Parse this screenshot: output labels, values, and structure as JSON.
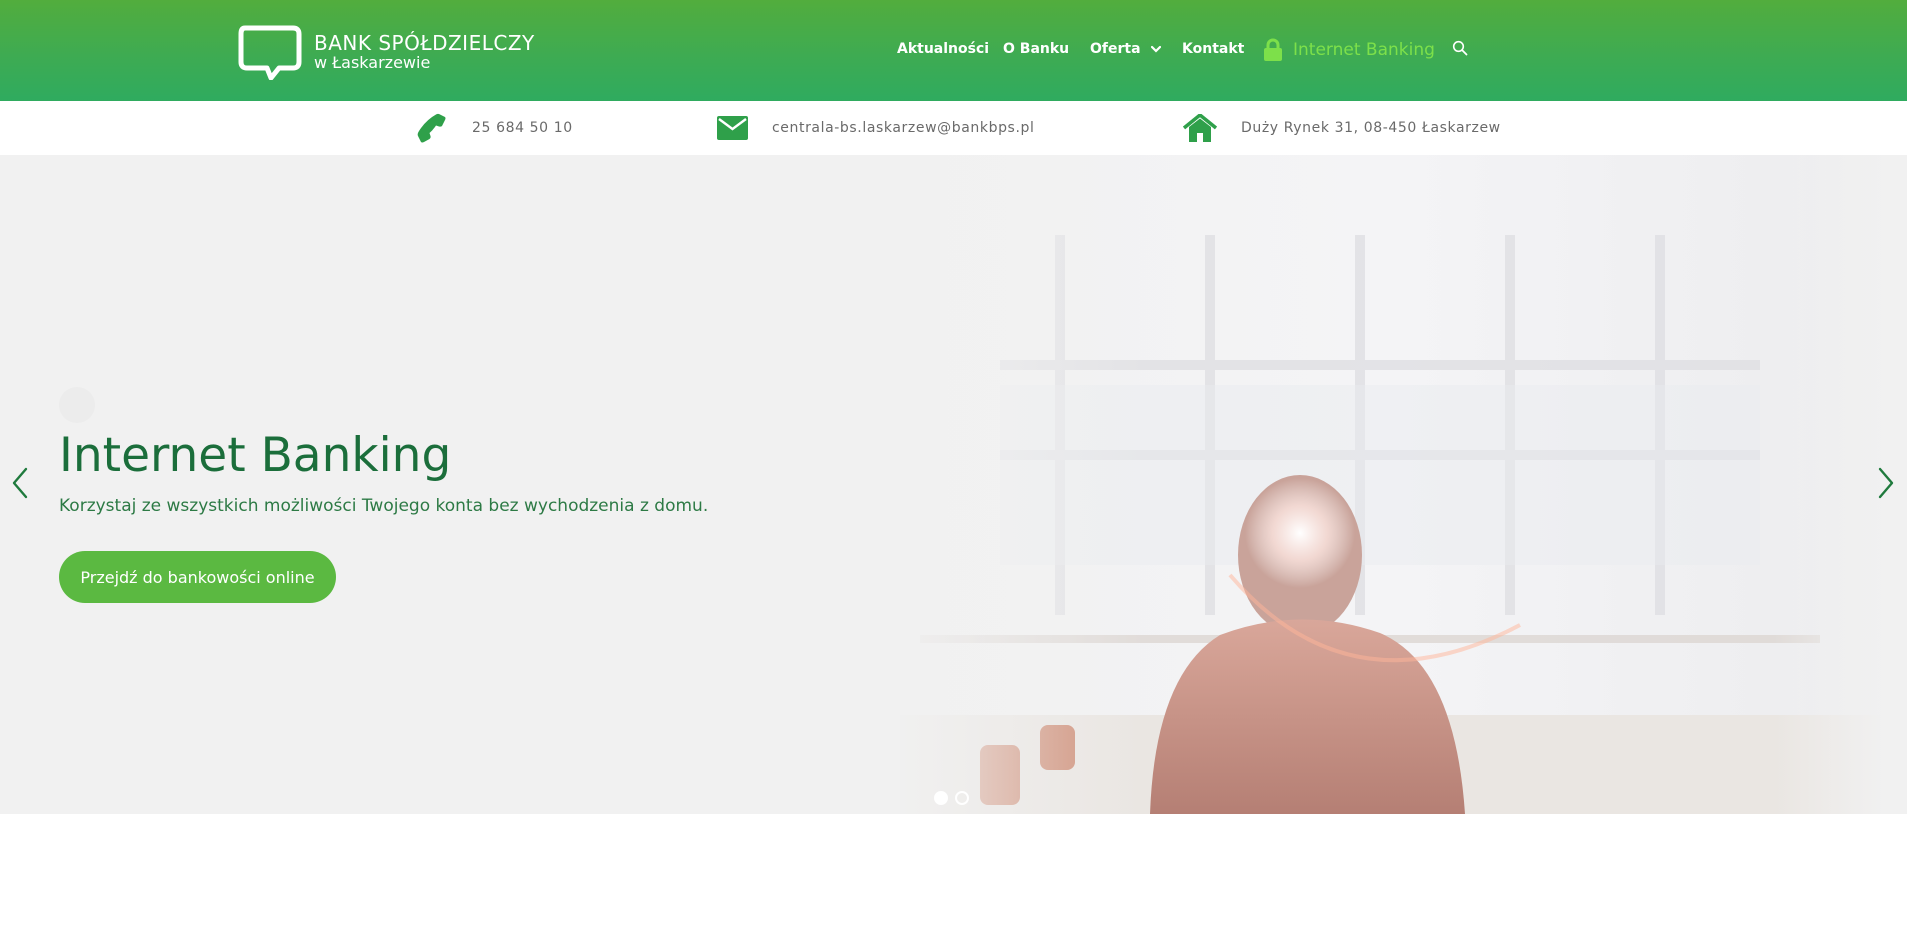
{
  "brand": {
    "name_line1": "BANK SPÓŁDZIELCZY",
    "name_line2": "w Łaskarzewie"
  },
  "nav": {
    "items": [
      {
        "label": "Aktualności"
      },
      {
        "label": "O Banku"
      },
      {
        "label": "Oferta",
        "has_dropdown": true
      },
      {
        "label": "Kontakt"
      }
    ],
    "internet_banking_label": "Internet Banking"
  },
  "contacts": {
    "phone": "25 684 50 10",
    "email": "centrala-bs.laskarzew@bankbps.pl",
    "address": "Duży Rynek 31, 08-450 Łaskarzew"
  },
  "hero": {
    "title": "Internet Banking",
    "subtitle": "Korzystaj ze wszystkich możliwości Twojego konta bez wychodzenia z domu.",
    "cta_label": "Przejdź do bankowości online",
    "slide_count": 2,
    "active_slide": 1
  },
  "colors": {
    "header_green": "#3eab52",
    "accent_green": "#5bb941",
    "icon_green": "#2fa04a",
    "title_green": "#1b6e3b",
    "ib_link": "#7de04a"
  },
  "icons": {
    "search": "search-icon",
    "lock": "lock-icon",
    "phone": "phone-icon",
    "email": "envelope-icon",
    "address": "home-icon"
  }
}
